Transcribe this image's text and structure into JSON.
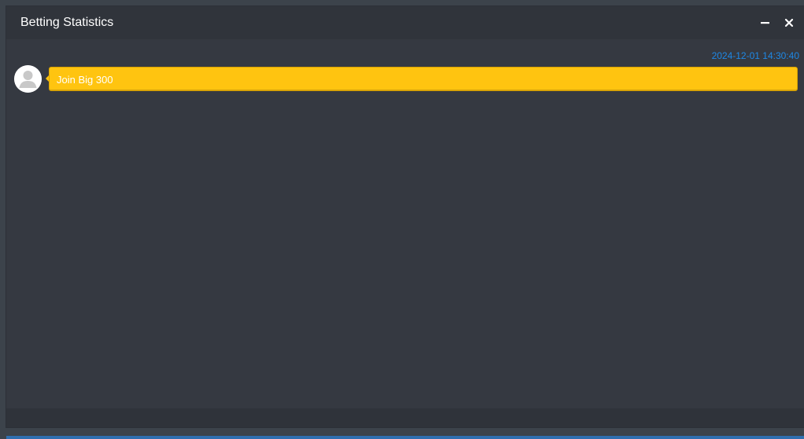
{
  "window": {
    "title": "Betting Statistics",
    "controls": {
      "minimize_icon": "minimize-icon",
      "close_icon": "close-icon"
    }
  },
  "message": {
    "timestamp": "2024-12-01 14:30:40",
    "avatar_icon": "user-avatar-icon",
    "text": "Join Big 300"
  },
  "colors": {
    "bubble": "#ffc410",
    "timestamp": "#1e88e5",
    "background": "#353941"
  }
}
